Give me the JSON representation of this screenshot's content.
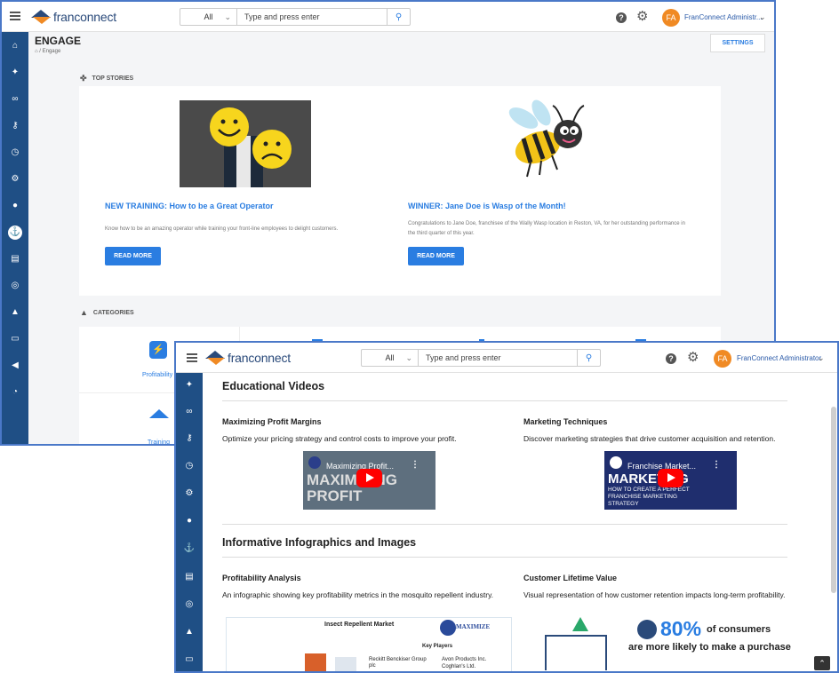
{
  "topbar": {
    "menu_icon": "hamburger-icon",
    "logo_text": "franconnect",
    "search_scope": "All",
    "search_placeholder": "Type and press enter",
    "user_initials": "FA",
    "user_name_short": "FranConnect Administr...",
    "user_name_full": "FranConnect Administrator"
  },
  "engage": {
    "title": "ENGAGE",
    "breadcrumb": "/ Engage",
    "settings_label": "SETTINGS",
    "top_stories_label": "TOP STORIES",
    "categories_label": "CATEGORIES",
    "stories": [
      {
        "title": "NEW TRAINING: How to be a Great Operator",
        "description": "Know how to be an amazing operator while training your front-line employees to delight customers.",
        "button": "READ MORE"
      },
      {
        "title": "WINNER: Jane Doe is Wasp of the Month!",
        "description": "Congratulations to Jane Doe, franchisee of the Wally Wasp location in Reston, VA, for her outstanding performance in the third quarter of this year.",
        "button": "READ MORE"
      }
    ],
    "categories": [
      {
        "label": "Profitability",
        "icon": "gear-dollar-icon"
      },
      {
        "label": "Training",
        "icon": "graduation-cap-icon"
      }
    ]
  },
  "content": {
    "videos_heading": "Educational Videos",
    "videos": [
      {
        "title": "Maximizing Profit Margins",
        "description": "Optimize your pricing strategy and control costs to improve your profit.",
        "thumb_title": "Maximizing Profit...",
        "thumb_text": "MAXIMIZING PROFIT"
      },
      {
        "title": "Marketing Techniques",
        "description": "Discover marketing strategies that drive customer acquisition and retention.",
        "thumb_title": "Franchise Market...",
        "thumb_text": "MARKETING",
        "thumb_sub": "HOW TO CREATE A PERFECT FRANCHISE MARKETING STRATEGY"
      }
    ],
    "infographics_heading": "Informative Infographics and Images",
    "infographics": [
      {
        "title": "Profitability Analysis",
        "description": "An infographic showing key profitability metrics in the mosquito repellent industry.",
        "image_title": "Insect Repellent Market",
        "image_subtitle": "Key Players",
        "image_brand": "MAXIMIZE",
        "players": [
          "Reckitt Benckiser Group plc",
          "Avon Products Inc.",
          "Coghlan's Ltd."
        ]
      },
      {
        "title": "Customer Lifetime Value",
        "description": "Visual representation of how customer retention impacts long-term profitability.",
        "stat": "80%",
        "stat_suffix": "of consumers",
        "stat_line2": "are more likely to make a purchase"
      }
    ]
  },
  "colors": {
    "sidebar": "#1f4f85",
    "accent": "#2a7de1",
    "window_border": "#4a78c8",
    "avatar": "#f08a24",
    "play": "#ff0000"
  }
}
